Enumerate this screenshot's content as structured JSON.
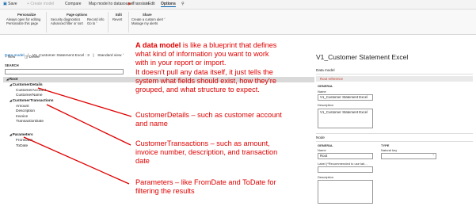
{
  "toolbar": {
    "save": "Save",
    "create_model": "Create model",
    "compare": "Compare",
    "map_model": "Map model to datasource",
    "translate": "Translate",
    "tabs": [
      "Edit",
      "Options"
    ]
  },
  "ribbon": {
    "personalize": {
      "title": "Personalize",
      "items": [
        "Always open for editing",
        "Personalize this page"
      ]
    },
    "page_options": {
      "title": "Page options",
      "items": [
        "Security diagnostics",
        "Advanced filter or sort",
        "Record info",
        "Go to"
      ]
    },
    "edit": {
      "title": "Edit",
      "items": [
        "Revert"
      ]
    },
    "share": {
      "title": "Share",
      "items": [
        "Create a custom alert",
        "Manage my alerts"
      ]
    }
  },
  "breadcrumb": {
    "root": "Data model",
    "sep": "|",
    "item": "V1_Customer Statement Excel : 3",
    "sep2": "|",
    "view": "Standard view"
  },
  "actions": {
    "new": "New",
    "delete": "Delete"
  },
  "search": {
    "label": "SEARCH"
  },
  "tree": [
    {
      "label": "Root",
      "bold": true
    },
    {
      "label": "CustomerDetails",
      "bold": true
    },
    {
      "label": "CustomerAccount",
      "bold": false
    },
    {
      "label": "CustomerName",
      "bold": false
    },
    {
      "label": "CustomerTransactions",
      "bold": true
    },
    {
      "label": "Amount",
      "bold": false
    },
    {
      "label": "Description",
      "bold": false
    },
    {
      "label": "Invoice",
      "bold": false
    },
    {
      "label": "TransactionDate",
      "bold": false
    },
    {
      "label": "Parameters",
      "bold": true
    },
    {
      "label": "FromDate",
      "bold": false
    },
    {
      "label": "ToDate",
      "bold": false
    }
  ],
  "panel": {
    "title": "V1_Customer Statement Excel",
    "data_model": {
      "section": "Data model",
      "root_reference": "Root reference",
      "general": "GENERAL",
      "name_label": "Name",
      "name_value": "V1_Customer Statement Excel",
      "desc_label": "Description",
      "desc_value": "V1_Customer Statement Excel"
    },
    "node": {
      "section": "Node",
      "general": "GENERAL",
      "type": "TYPE",
      "name_label": "Name",
      "name_value": "Root",
      "natural_key": "Natural key",
      "label_label": "Label (*Recommended to use lab...",
      "desc_label": "Description"
    }
  },
  "notes": {
    "main": [
      {
        "bold": "A data model",
        "rest": " is like a blueprint that defines"
      },
      {
        "bold": "",
        "rest": "what kind of information you want to work"
      },
      {
        "bold": "",
        "rest": "with in your report or import."
      },
      {
        "bold": "",
        "rest": "It doesn't pull any data itself, it just tells the"
      },
      {
        "bold": "",
        "rest": "system what fields should exist, how they're"
      },
      {
        "bold": "",
        "rest": "grouped, and what structure to expect."
      }
    ],
    "customer_details": [
      "CustomerDetails – such as customer account",
      "and name"
    ],
    "customer_transactions": [
      "CustomerTransactions – such as amount,",
      "invoice number, description, and transaction",
      "date"
    ],
    "parameters": [
      "Parameters – like FromDate and ToDate for",
      "filtering the results"
    ]
  },
  "colors": {
    "annotation": "#e00000",
    "accent": "#0063b1"
  }
}
